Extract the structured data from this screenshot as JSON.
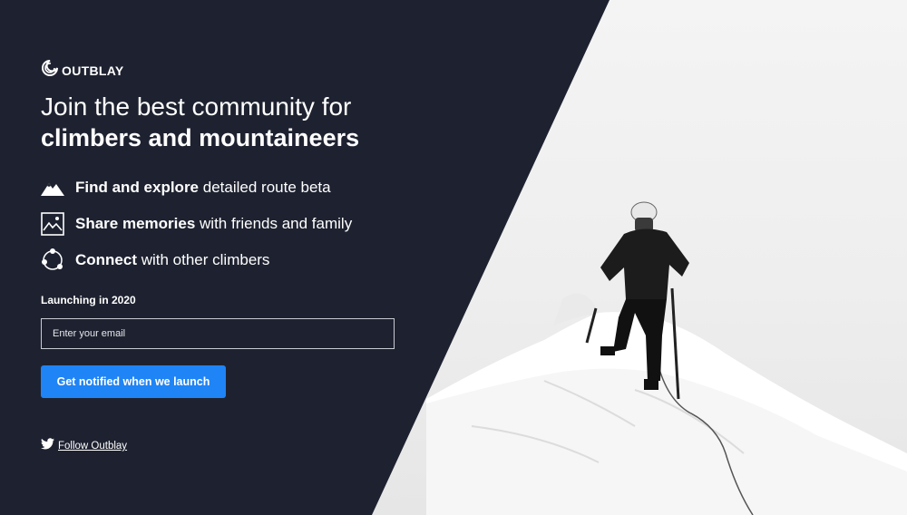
{
  "brand": {
    "name": "OUTBLAY",
    "logo_icon": "crescent-logo-icon"
  },
  "headline": {
    "line1": "Join the best community for",
    "line2": "climbers and mountaineers"
  },
  "features": [
    {
      "icon": "mountain-icon",
      "bold": "Find and explore",
      "rest": " detailed route beta"
    },
    {
      "icon": "photo-icon",
      "bold": "Share memories",
      "rest": " with friends and family"
    },
    {
      "icon": "connect-icon",
      "bold": "Connect",
      "rest": " with other climbers"
    }
  ],
  "signup": {
    "label": "Launching in 2020",
    "email_placeholder": "Enter your email",
    "email_value": "",
    "button_label": "Get notified when we launch"
  },
  "social": {
    "icon": "twitter-icon",
    "link_text": "Follow Outblay"
  },
  "colors": {
    "panel_bg": "#1e2230",
    "accent": "#1f84f5"
  }
}
